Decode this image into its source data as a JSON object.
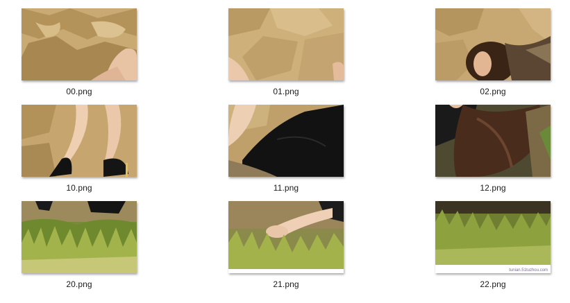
{
  "files": [
    {
      "name": "00.png"
    },
    {
      "name": "01.png"
    },
    {
      "name": "02.png"
    },
    {
      "name": "10.png"
    },
    {
      "name": "11.png"
    },
    {
      "name": "12.png"
    },
    {
      "name": "20.png"
    },
    {
      "name": "21.png"
    },
    {
      "name": "22.png",
      "watermark": "tunian.51tuzhou.com"
    }
  ]
}
